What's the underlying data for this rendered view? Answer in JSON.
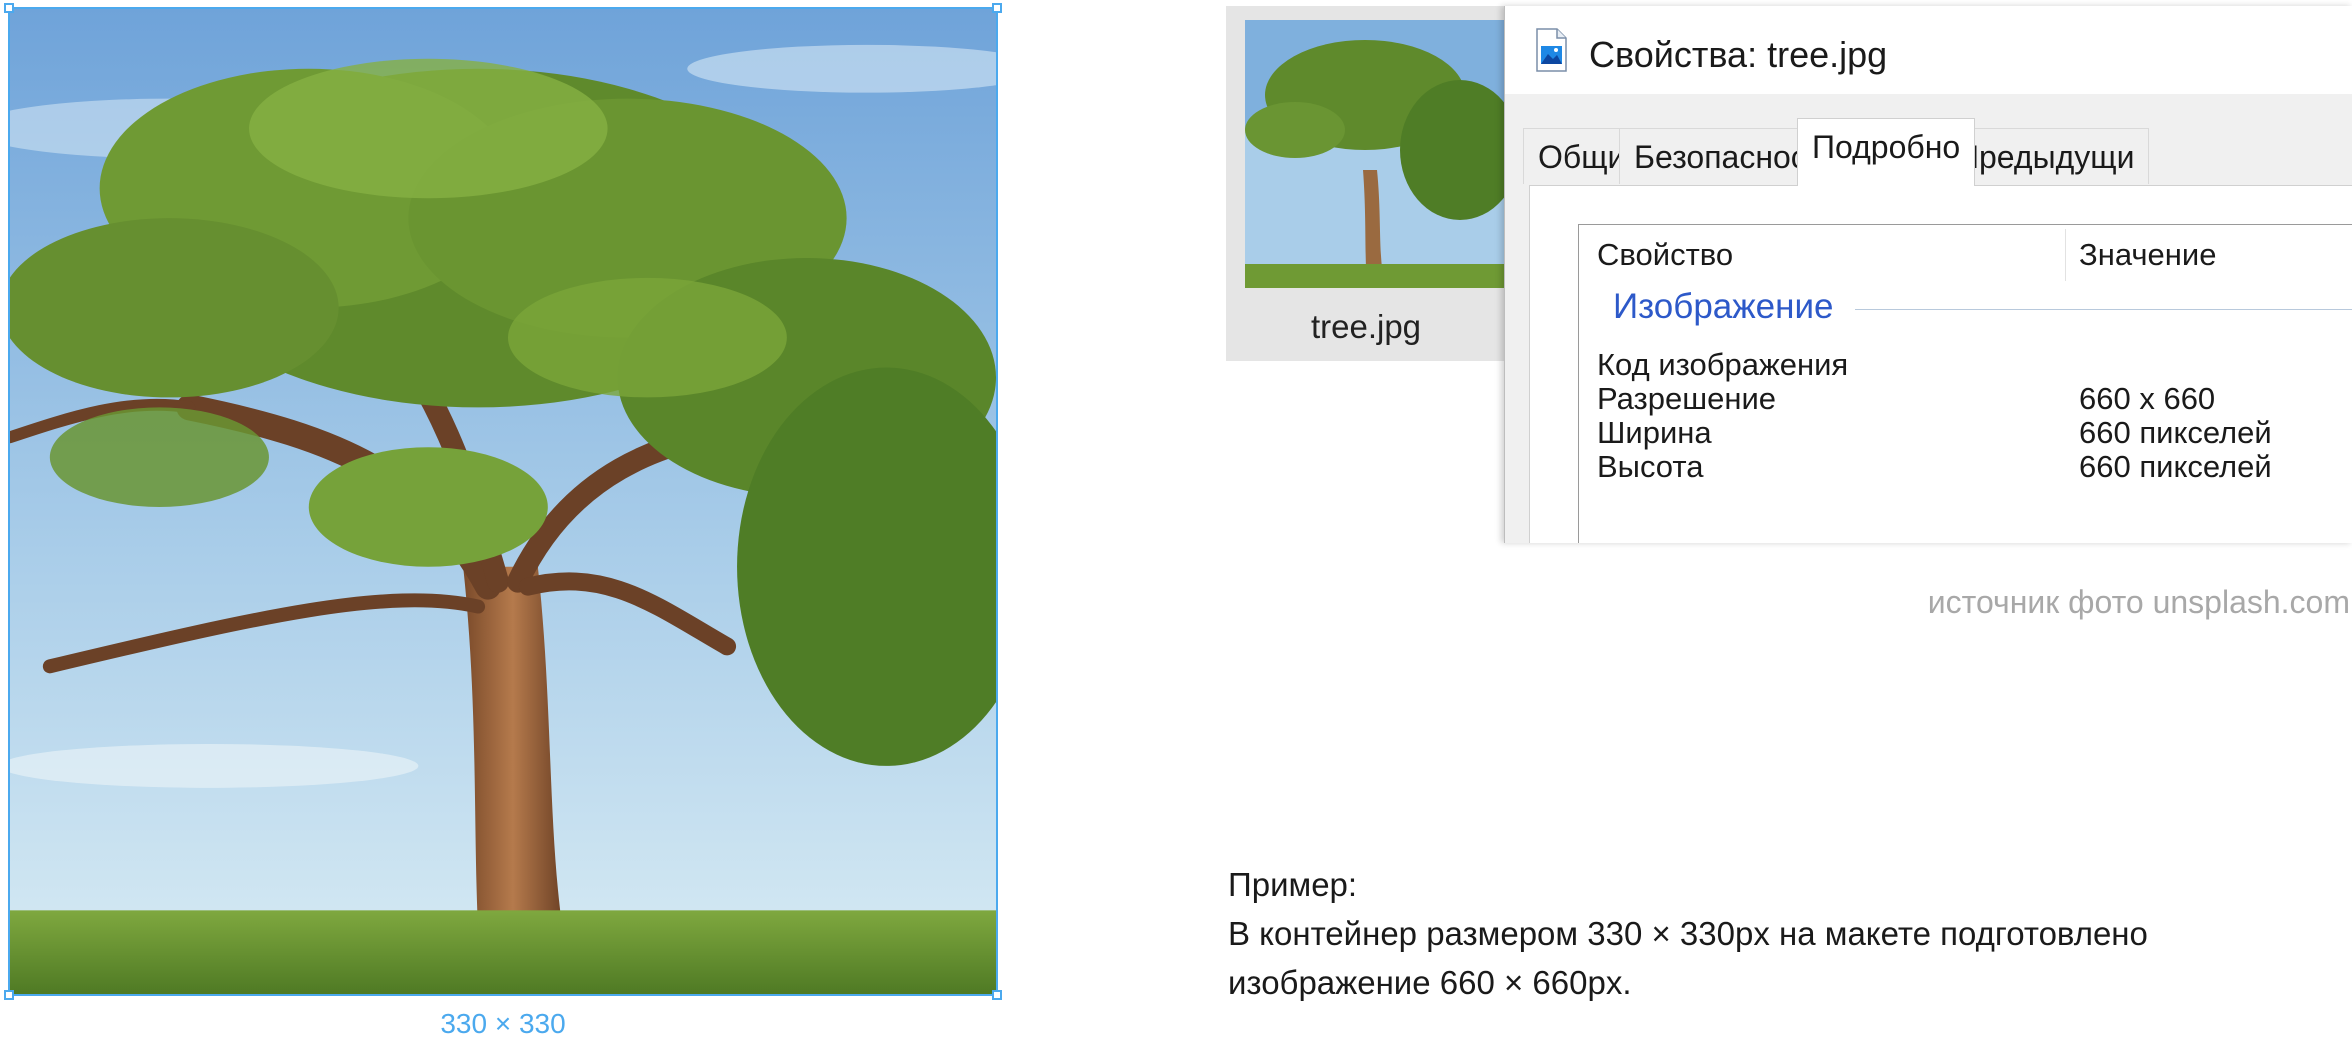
{
  "canvas": {
    "frame_label": "330 × 330",
    "accent_color": "#4ba9ee"
  },
  "thumbnail": {
    "filename": "tree.jpg"
  },
  "dialog": {
    "title": "Свойства: tree.jpg",
    "title_icon": "image-file-icon",
    "tabs": [
      {
        "label": "Общие",
        "active": false
      },
      {
        "label": "Безопасность",
        "active": false
      },
      {
        "label": "Подробно",
        "active": true
      },
      {
        "label": "Предыдущи",
        "active": false
      }
    ],
    "columns": {
      "property": "Свойство",
      "value": "Значение"
    },
    "group": "Изображение",
    "rows": [
      {
        "key": "Код изображения",
        "value": ""
      },
      {
        "key": "Разрешение",
        "value": "660 x 660"
      },
      {
        "key": "Ширина",
        "value": "660 пикселей"
      },
      {
        "key": "Высота",
        "value": "660 пикселей"
      }
    ]
  },
  "source_note": "источник фото unsplash.com",
  "example": {
    "heading": "Пример:",
    "line1": "В контейнер размером 330 × 330px на макете подготовлено",
    "line2": "изображение 660 × 660px."
  }
}
